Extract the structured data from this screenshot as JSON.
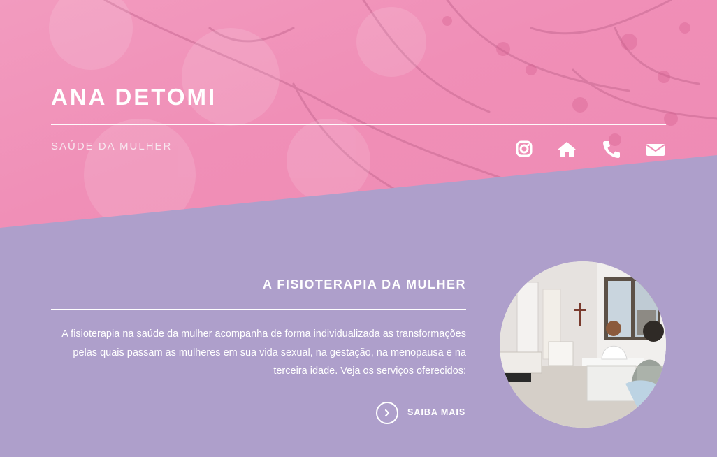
{
  "header": {
    "title": "ANA DETOMI",
    "tagline": "SAÚDE DA MULHER",
    "social_icons": [
      "instagram-icon",
      "home-icon",
      "phone-icon",
      "envelope-icon"
    ]
  },
  "main": {
    "section_title": "A FISIOTERAPIA DA MULHER",
    "description": "A fisioterapia na saúde da mulher acompanha de forma individualizada as transformações pelas quais passam as mulheres em sua vida sexual, na gestação, na menopausa e na terceira idade. Veja os serviços oferecidos:",
    "cta_label": "SAIBA MAIS",
    "cta_icon": "chevron-right-icon"
  },
  "colors": {
    "hero_pink": "#f08fb7",
    "content_lavender": "#ae9fcb",
    "text": "#ffffff"
  }
}
